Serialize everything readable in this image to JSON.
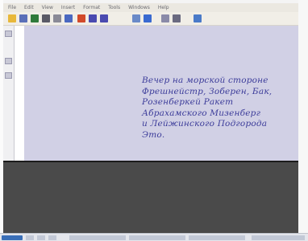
{
  "menubar": {
    "items": [
      {
        "label": "File"
      },
      {
        "label": "Edit"
      },
      {
        "label": "View"
      },
      {
        "label": "Insert"
      },
      {
        "label": "Format"
      },
      {
        "label": "Tools"
      },
      {
        "label": "Windows"
      },
      {
        "label": "Help"
      }
    ]
  },
  "toolbar": {
    "icons": [
      {
        "name": "new-icon",
        "color": "#e8b83a"
      },
      {
        "name": "open-icon",
        "color": "#5a6fb8"
      },
      {
        "name": "save-icon",
        "color": "#2f7a3a"
      },
      {
        "name": "print-icon",
        "color": "#5a5a66"
      },
      {
        "name": "cut-icon",
        "color": "#8a8a96"
      },
      {
        "name": "copy-icon",
        "color": "#4a68c0"
      },
      {
        "name": "paste-icon",
        "color": "#d24a2a"
      },
      {
        "name": "undo-icon",
        "color": "#4a4ab0"
      },
      {
        "name": "redo-icon",
        "color": "#4a4ab0"
      },
      {
        "name": "table-icon",
        "color": "#6a8ac8"
      },
      {
        "name": "chart-icon",
        "color": "#3a6ad0"
      },
      {
        "name": "draw-icon",
        "color": "#8a8aa8"
      },
      {
        "name": "zoom-icon",
        "color": "#6a6a80"
      },
      {
        "name": "help-icon",
        "color": "#4a7ac8"
      }
    ]
  },
  "document": {
    "text_lines": [
      "Вечер на морской стороне",
      "Фрешнейстр, Зоберен, Бак,",
      "Розенберкей Ракет",
      "Абрахамского Мизенберг",
      "и Лейжинского Подгорода",
      "Это."
    ]
  },
  "colors": {
    "canvas_background": "#d1d0e5",
    "text": "#3c3c9a",
    "dark_area": "#4a4a4a"
  }
}
